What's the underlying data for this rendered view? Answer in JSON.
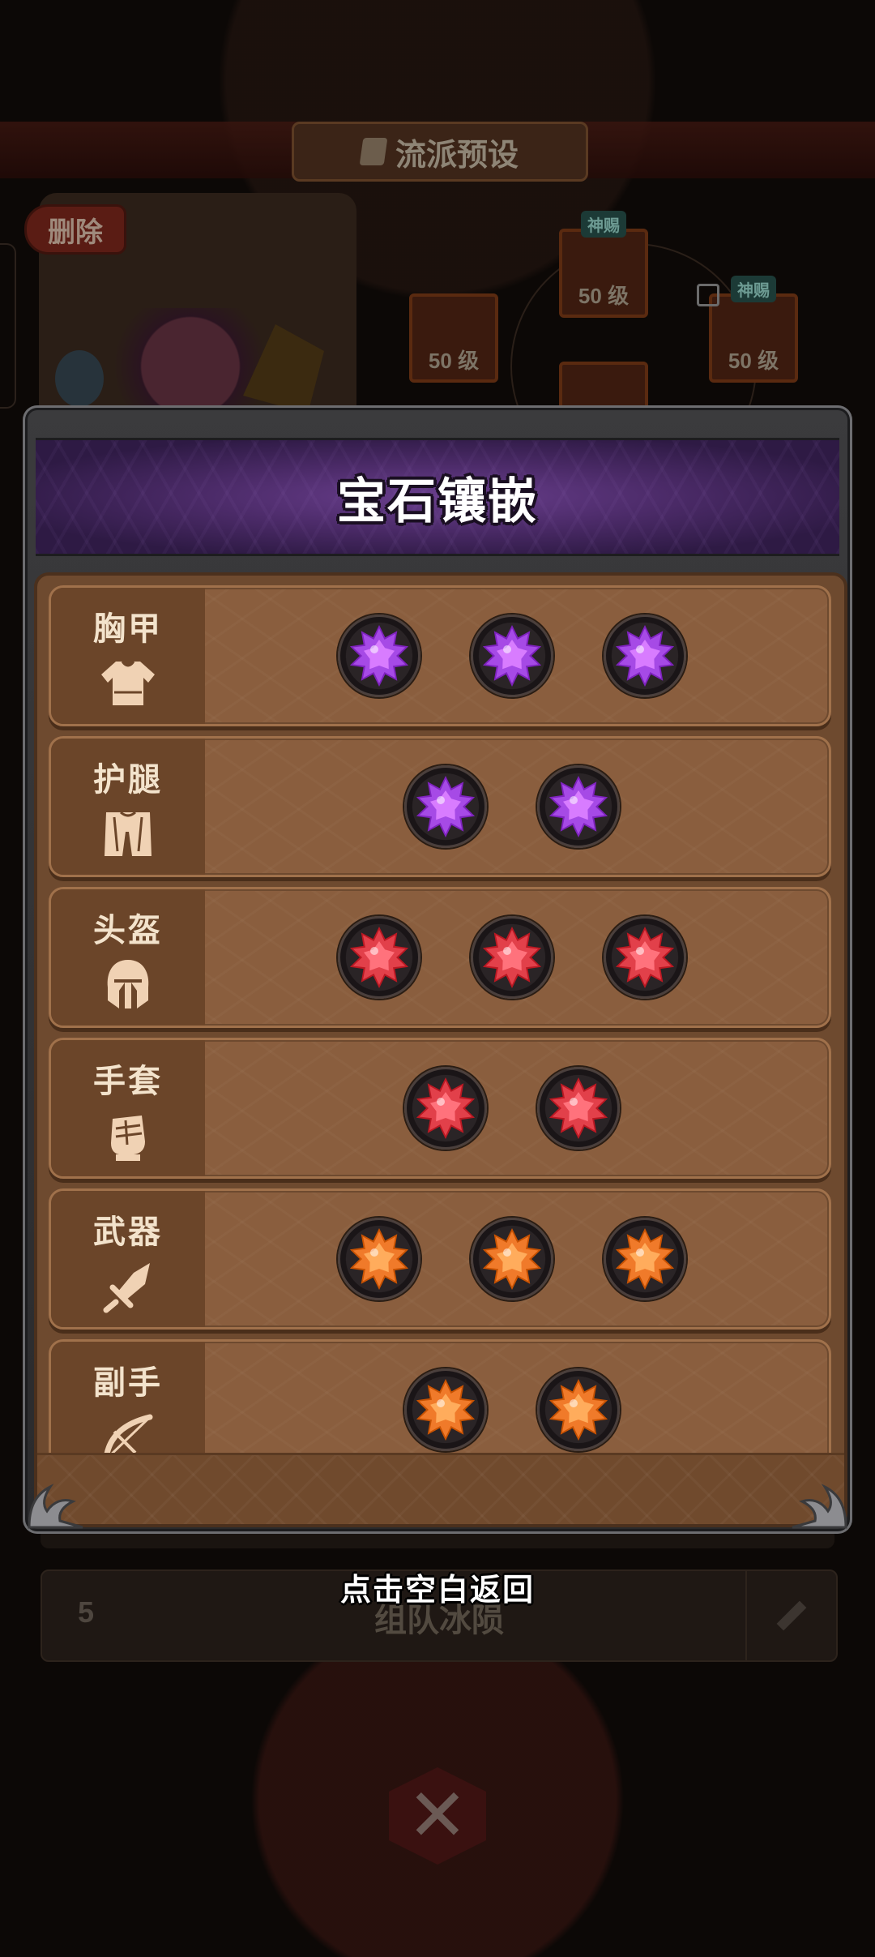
{
  "background": {
    "title": "流派预设",
    "delete_label": "删除",
    "equipment": [
      {
        "level": "50 级",
        "tag": ""
      },
      {
        "level": "50 级",
        "tag": "神赐"
      },
      {
        "level": "50 级",
        "tag": "神赐"
      },
      {
        "level": "",
        "tag": ""
      }
    ],
    "preset_number": "5",
    "preset_name": "组队冰陨"
  },
  "modal": {
    "title": "宝石镶嵌",
    "slots": [
      {
        "label": "胸甲",
        "icon": "chest-armor-icon",
        "gems": [
          "purple",
          "purple",
          "purple"
        ]
      },
      {
        "label": "护腿",
        "icon": "leg-guard-icon",
        "gems": [
          "purple",
          "purple"
        ]
      },
      {
        "label": "头盔",
        "icon": "helmet-icon",
        "gems": [
          "red",
          "red",
          "red"
        ]
      },
      {
        "label": "手套",
        "icon": "glove-icon",
        "gems": [
          "red",
          "red"
        ]
      },
      {
        "label": "武器",
        "icon": "sword-icon",
        "gems": [
          "orange",
          "orange",
          "orange"
        ]
      },
      {
        "label": "副手",
        "icon": "bow-icon",
        "gems": [
          "orange",
          "orange"
        ]
      }
    ]
  },
  "hint": "点击空白返回",
  "colors": {
    "purple": "#a64ae6",
    "red": "#e2404a",
    "orange": "#f07a2a",
    "slot_bg": "#8a5e3e",
    "label_col": "#6b4529"
  }
}
